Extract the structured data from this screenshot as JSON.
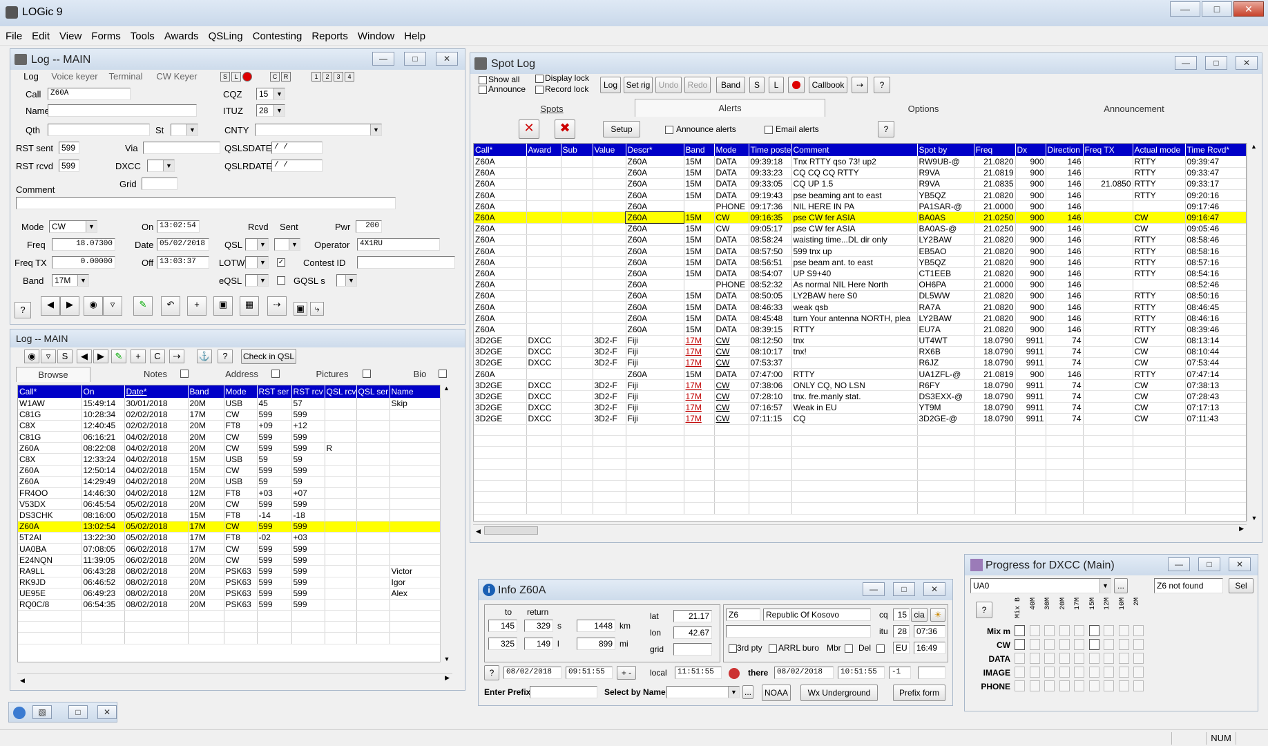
{
  "app": {
    "title": "LOGic 9"
  },
  "menu": [
    "File",
    "Edit",
    "View",
    "Forms",
    "Tools",
    "Awards",
    "QSLing",
    "Contesting",
    "Reports",
    "Window",
    "Help"
  ],
  "logwin": {
    "title": "Log -- MAIN",
    "tabs": [
      "Log",
      "Voice keyer",
      "Terminal",
      "CW Keyer"
    ],
    "mini": [
      "S",
      "L",
      "",
      "C",
      "R",
      "1",
      "2",
      "3",
      "4"
    ],
    "call_label": "Call",
    "call": "Z60A",
    "cqz_label": "CQZ",
    "cqz": "15",
    "name_label": "Name",
    "ituz_label": "ITUZ",
    "ituz": "28",
    "qth_label": "Qth",
    "st_label": "St",
    "cnty_label": "CNTY",
    "rstsent_label": "RST sent",
    "rstsent": "599",
    "via_label": "Via",
    "qslsdate_label": "QSLSDATE",
    "qslsdate": "  /  /",
    "rstrcvd_label": "RST rcvd",
    "rstrcvd": "599",
    "dxcc_label": "DXCC",
    "qslrdate_label": "QSLRDATE",
    "qslrdate": "  /  /",
    "grid_label": "Grid",
    "comment_label": "Comment",
    "mode_label": "Mode",
    "mode": "CW",
    "on_label": "On",
    "on": "13:02:54",
    "rcvd_label": "Rcvd",
    "sent_label": "Sent",
    "pwr_label": "Pwr",
    "pwr": "200",
    "freq_label": "Freq",
    "freq": "18.07300",
    "date_label": "Date",
    "date": "05/02/2018",
    "qsl_label": "QSL",
    "operator_label": "Operator",
    "operator": "4X1RU",
    "freqtx_label": "Freq TX",
    "freqtx": "0.00000",
    "off_label": "Off",
    "off": "13:03:37",
    "lotw_label": "LOTW",
    "contestid_label": "Contest ID",
    "band_label": "Band",
    "band": "17M",
    "eqsl_label": "eQSL",
    "gqsl_label": "GQSL s"
  },
  "browse": {
    "title": "Log -- MAIN",
    "checkin": "Check in QSL",
    "tabs": [
      "Browse",
      "Notes",
      "Address",
      "Pictures",
      "Bio"
    ],
    "columns": [
      "Call*",
      "On",
      "Date*",
      "Band",
      "Mode",
      "RST ser",
      "RST rcv",
      "QSL rcv",
      "QSL ser",
      "Name"
    ],
    "rows": [
      [
        "W1AW",
        "15:49:14",
        "30/01/2018",
        "20M",
        "USB",
        "45",
        "57",
        "",
        "",
        "Skip"
      ],
      [
        "C81G",
        "10:28:34",
        "02/02/2018",
        "17M",
        "CW",
        "599",
        "599",
        "",
        "",
        ""
      ],
      [
        "C8X",
        "12:40:45",
        "02/02/2018",
        "20M",
        "FT8",
        "+09",
        "+12",
        "",
        "",
        ""
      ],
      [
        "C81G",
        "06:16:21",
        "04/02/2018",
        "20M",
        "CW",
        "599",
        "599",
        "",
        "",
        ""
      ],
      [
        "Z60A",
        "08:22:08",
        "04/02/2018",
        "20M",
        "CW",
        "599",
        "599",
        "R",
        "",
        ""
      ],
      [
        "C8X",
        "12:33:24",
        "04/02/2018",
        "15M",
        "USB",
        "59",
        "59",
        "",
        "",
        ""
      ],
      [
        "Z60A",
        "12:50:14",
        "04/02/2018",
        "15M",
        "CW",
        "599",
        "599",
        "",
        "",
        ""
      ],
      [
        "Z60A",
        "14:29:49",
        "04/02/2018",
        "20M",
        "USB",
        "59",
        "59",
        "",
        "",
        ""
      ],
      [
        "FR4OO",
        "14:46:30",
        "04/02/2018",
        "12M",
        "FT8",
        "+03",
        "+07",
        "",
        "",
        ""
      ],
      [
        "V53DX",
        "06:45:54",
        "05/02/2018",
        "20M",
        "CW",
        "599",
        "599",
        "",
        "",
        ""
      ],
      [
        "DS3CHK",
        "08:16:00",
        "05/02/2018",
        "15M",
        "FT8",
        "-14",
        "-18",
        "",
        "",
        ""
      ],
      [
        "Z60A",
        "13:02:54",
        "05/02/2018",
        "17M",
        "CW",
        "599",
        "599",
        "",
        "",
        ""
      ],
      [
        "5T2AI",
        "13:22:30",
        "05/02/2018",
        "17M",
        "FT8",
        "-02",
        "+03",
        "",
        "",
        ""
      ],
      [
        "UA0BA",
        "07:08:05",
        "06/02/2018",
        "17M",
        "CW",
        "599",
        "599",
        "",
        "",
        ""
      ],
      [
        "E24NQN",
        "11:39:05",
        "06/02/2018",
        "20M",
        "CW",
        "599",
        "599",
        "",
        "",
        ""
      ],
      [
        "RA9LL",
        "06:43:28",
        "08/02/2018",
        "20M",
        "PSK63",
        "599",
        "599",
        "",
        "",
        "Victor"
      ],
      [
        "RK9JD",
        "06:46:52",
        "08/02/2018",
        "20M",
        "PSK63",
        "599",
        "599",
        "",
        "",
        "Igor"
      ],
      [
        "UE95E",
        "06:49:23",
        "08/02/2018",
        "20M",
        "PSK63",
        "599",
        "599",
        "",
        "",
        "Alex"
      ],
      [
        "RQ0C/8",
        "06:54:35",
        "08/02/2018",
        "20M",
        "PSK63",
        "599",
        "599",
        "",
        "",
        ""
      ]
    ]
  },
  "spot": {
    "title": "Spot Log",
    "showall": "Show all",
    "announce": "Announce",
    "displaylock": "Display lock",
    "recordlock": "Record lock",
    "buttons": [
      "Log",
      "Set rig",
      "Undo",
      "Redo",
      "Band",
      "S",
      "L",
      "",
      "Callbook"
    ],
    "tabs": [
      "Spots",
      "Alerts",
      "Options",
      "Announcement"
    ],
    "setup": "Setup",
    "announce_alerts": "Announce alerts",
    "email_alerts": "Email alerts",
    "columns": [
      "Call*",
      "Award",
      "Sub",
      "Value",
      "Descr*",
      "Band",
      "Mode",
      "Time poste",
      "Comment",
      "Spot by",
      "Freq",
      "Dx",
      "Direction",
      "Freq TX",
      "Actual mode",
      "Time Rcvd*"
    ],
    "rows": [
      [
        "Z60A",
        "",
        "",
        "",
        "Z60A",
        "15M",
        "DATA",
        "09:39:18",
        "Tnx RTTY qso 73! up2",
        "RW9UB-@",
        "21.0820",
        "900",
        "146",
        "",
        "RTTY",
        "09:39:47"
      ],
      [
        "Z60A",
        "",
        "",
        "",
        "Z60A",
        "15M",
        "DATA",
        "09:33:23",
        "CQ CQ CQ RTTY",
        "R9VA",
        "21.0819",
        "900",
        "146",
        "",
        "RTTY",
        "09:33:47"
      ],
      [
        "Z60A",
        "",
        "",
        "",
        "Z60A",
        "15M",
        "DATA",
        "09:33:05",
        "CQ UP 1.5",
        "R9VA",
        "21.0835",
        "900",
        "146",
        "21.0850",
        "RTTY",
        "09:33:17"
      ],
      [
        "Z60A",
        "",
        "",
        "",
        "Z60A",
        "15M",
        "DATA",
        "09:19:43",
        "pse beaming ant to east",
        "YB5QZ",
        "21.0820",
        "900",
        "146",
        "",
        "RTTY",
        "09:20:16"
      ],
      [
        "Z60A",
        "",
        "",
        "",
        "Z60A",
        "",
        "PHONE",
        "09:17:36",
        "NIL HERE IN PA",
        "PA1SAR-@",
        "21.0000",
        "900",
        "146",
        "",
        "",
        "09:17:46"
      ],
      [
        "Z60A",
        "",
        "",
        "",
        "Z60A",
        "15M",
        "CW",
        "09:16:35",
        "pse CW fer ASIA",
        "BA0AS",
        "21.0250",
        "900",
        "146",
        "",
        "CW",
        "09:16:47"
      ],
      [
        "Z60A",
        "",
        "",
        "",
        "Z60A",
        "15M",
        "CW",
        "09:05:17",
        "pse CW fer ASIA",
        "BA0AS-@",
        "21.0250",
        "900",
        "146",
        "",
        "CW",
        "09:05:46"
      ],
      [
        "Z60A",
        "",
        "",
        "",
        "Z60A",
        "15M",
        "DATA",
        "08:58:24",
        "waisting time...DL dir only",
        "LY2BAW",
        "21.0820",
        "900",
        "146",
        "",
        "RTTY",
        "08:58:46"
      ],
      [
        "Z60A",
        "",
        "",
        "",
        "Z60A",
        "15M",
        "DATA",
        "08:57:50",
        "599 tnx up",
        "EB5AO",
        "21.0820",
        "900",
        "146",
        "",
        "RTTY",
        "08:58:16"
      ],
      [
        "Z60A",
        "",
        "",
        "",
        "Z60A",
        "15M",
        "DATA",
        "08:56:51",
        "pse beam ant. to east",
        "YB5QZ",
        "21.0820",
        "900",
        "146",
        "",
        "RTTY",
        "08:57:16"
      ],
      [
        "Z60A",
        "",
        "",
        "",
        "Z60A",
        "15M",
        "DATA",
        "08:54:07",
        "UP S9+40",
        "CT1EEB",
        "21.0820",
        "900",
        "146",
        "",
        "RTTY",
        "08:54:16"
      ],
      [
        "Z60A",
        "",
        "",
        "",
        "Z60A",
        "",
        "PHONE",
        "08:52:32",
        "As normal NIL Here North",
        "OH6PA",
        "21.0000",
        "900",
        "146",
        "",
        "",
        "08:52:46"
      ],
      [
        "Z60A",
        "",
        "",
        "",
        "Z60A",
        "15M",
        "DATA",
        "08:50:05",
        "LY2BAW here S0",
        "DL5WW",
        "21.0820",
        "900",
        "146",
        "",
        "RTTY",
        "08:50:16"
      ],
      [
        "Z60A",
        "",
        "",
        "",
        "Z60A",
        "15M",
        "DATA",
        "08:46:33",
        "weak qsb",
        "RA7A",
        "21.0820",
        "900",
        "146",
        "",
        "RTTY",
        "08:46:45"
      ],
      [
        "Z60A",
        "",
        "",
        "",
        "Z60A",
        "15M",
        "DATA",
        "08:45:48",
        "turn Your antenna NORTH, plea",
        "LY2BAW",
        "21.0820",
        "900",
        "146",
        "",
        "RTTY",
        "08:46:16"
      ],
      [
        "Z60A",
        "",
        "",
        "",
        "Z60A",
        "15M",
        "DATA",
        "08:39:15",
        "RTTY",
        "EU7A",
        "21.0820",
        "900",
        "146",
        "",
        "RTTY",
        "08:39:46"
      ],
      [
        "3D2GE",
        "DXCC",
        "",
        "3D2-F",
        "Fiji",
        "17M",
        "CW",
        "08:12:50",
        "tnx",
        "UT4WT",
        "18.0790",
        "9911",
        "74",
        "",
        "CW",
        "08:13:14"
      ],
      [
        "3D2GE",
        "DXCC",
        "",
        "3D2-F",
        "Fiji",
        "17M",
        "CW",
        "08:10:17",
        "tnx!",
        "RX6B",
        "18.0790",
        "9911",
        "74",
        "",
        "CW",
        "08:10:44"
      ],
      [
        "3D2GE",
        "DXCC",
        "",
        "3D2-F",
        "Fiji",
        "17M",
        "CW",
        "07:53:37",
        "",
        "R6JZ",
        "18.0790",
        "9911",
        "74",
        "",
        "CW",
        "07:53:44"
      ],
      [
        "Z60A",
        "",
        "",
        "",
        "Z60A",
        "15M",
        "DATA",
        "07:47:00",
        "RTTY",
        "UA1ZFL-@",
        "21.0819",
        "900",
        "146",
        "",
        "RTTY",
        "07:47:14"
      ],
      [
        "3D2GE",
        "DXCC",
        "",
        "3D2-F",
        "Fiji",
        "17M",
        "CW",
        "07:38:06",
        "ONLY CQ, NO LSN",
        "R6FY",
        "18.0790",
        "9911",
        "74",
        "",
        "CW",
        "07:38:13"
      ],
      [
        "3D2GE",
        "DXCC",
        "",
        "3D2-F",
        "Fiji",
        "17M",
        "CW",
        "07:28:10",
        "tnx. fre.manly stat.",
        "DS3EXX-@",
        "18.0790",
        "9911",
        "74",
        "",
        "CW",
        "07:28:43"
      ],
      [
        "3D2GE",
        "DXCC",
        "",
        "3D2-F",
        "Fiji",
        "17M",
        "CW",
        "07:16:57",
        "Weak in EU",
        "YT9M",
        "18.0790",
        "9911",
        "74",
        "",
        "CW",
        "07:17:13"
      ],
      [
        "3D2GE",
        "DXCC",
        "",
        "3D2-F",
        "Fiji",
        "17M",
        "CW",
        "07:11:15",
        "CQ",
        "3D2GE-@",
        "18.0790",
        "9911",
        "74",
        "",
        "CW",
        "07:11:43"
      ]
    ]
  },
  "info": {
    "title": "Info Z60A",
    "to": "to",
    "return": "return",
    "s1": "145",
    "s2": "329",
    "s_unit": "s",
    "km": "1448",
    "km_unit": "km",
    "l1": "325",
    "l2": "149",
    "l_unit": "l",
    "mi": "899",
    "mi_unit": "mi",
    "lat_label": "lat",
    "lat": "21.17",
    "lon_label": "lon",
    "lon": "42.67",
    "grid_label": "grid",
    "prefix": "Z6",
    "country": "Republic Of Kosovo",
    "cq_label": "cq",
    "cq": "15",
    "cia": "cia",
    "itu_label": "itu",
    "itu": "28",
    "time1": "07:36",
    "cont": "EU",
    "time2": "16:49",
    "thirdpty": "3rd pty",
    "arrl": "ARRL buro",
    "mbr": "Mbr",
    "del": "Del",
    "date_local": "08/02/2018",
    "time_utc": "09:51:55",
    "plusminus": "+ -",
    "local_label": "local",
    "local": "11:51:55",
    "there_label": "there",
    "there_date": "08/02/2018",
    "there_time": "10:51:55",
    "offset": "-1",
    "enterprefix": "Enter Prefix",
    "selectbyname": "Select by Name",
    "noaa": "NOAA",
    "wx": "Wx Underground",
    "prefixform": "Prefix form"
  },
  "progress": {
    "title": "Progress for DXCC (Main)",
    "select": "UA0",
    "status": "Z6 not found",
    "sel": "Sel",
    "bands": [
      "Mix B",
      "40M",
      "30M",
      "20M",
      "17M",
      "15M",
      "12M",
      "10M",
      "2M"
    ],
    "rows": [
      "Mix m",
      "CW",
      "DATA",
      "IMAGE",
      "PHONE"
    ]
  },
  "status": {
    "num": "NUM"
  }
}
